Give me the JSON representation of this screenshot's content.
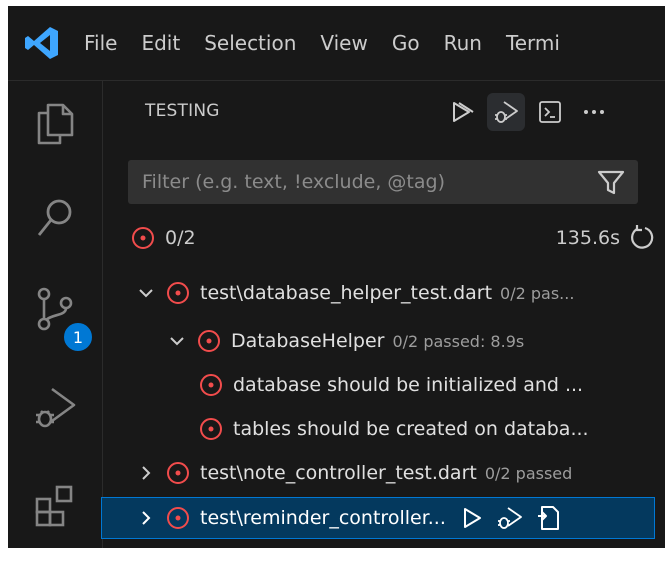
{
  "menubar": {
    "items": [
      "File",
      "Edit",
      "Selection",
      "View",
      "Go",
      "Run",
      "Termi"
    ]
  },
  "activity_bar": {
    "icons": [
      "explorer-icon",
      "search-icon",
      "source-control-icon",
      "run-debug-icon",
      "extensions-icon"
    ],
    "source_control_badge": "1"
  },
  "panel": {
    "title": "TESTING",
    "actions": [
      "run-all-tests-icon",
      "debug-all-tests-icon",
      "terminal-icon",
      "more-actions-icon"
    ],
    "filter": {
      "placeholder": "Filter (e.g. text, !exclude, @tag)",
      "value": ""
    },
    "summary": {
      "result": "0/2",
      "duration": "135.6s"
    },
    "tree": [
      {
        "label": "test\\database_helper_test.dart",
        "desc": "0/2 pas...",
        "level": 0,
        "expanded": true,
        "status": "failed"
      },
      {
        "label": "DatabaseHelper",
        "desc": "0/2 passed: 8.9s",
        "level": 1,
        "expanded": true,
        "status": "failed"
      },
      {
        "label": "database should be initialized and ...",
        "desc": "",
        "level": 2,
        "status": "failed"
      },
      {
        "label": "tables should be created on databa...",
        "desc": "",
        "level": 2,
        "status": "failed"
      },
      {
        "label": "test\\note_controller_test.dart",
        "desc": "0/2 passed",
        "level": 0,
        "expanded": false,
        "status": "failed"
      },
      {
        "label": "test\\reminder_controller...",
        "desc": "",
        "level": 0,
        "expanded": false,
        "status": "failed",
        "selected": true
      }
    ]
  },
  "colors": {
    "background": "#181818",
    "failed": "#f14c4c",
    "accent": "#0078d4",
    "vscode_blue": "#3ea6ff"
  }
}
